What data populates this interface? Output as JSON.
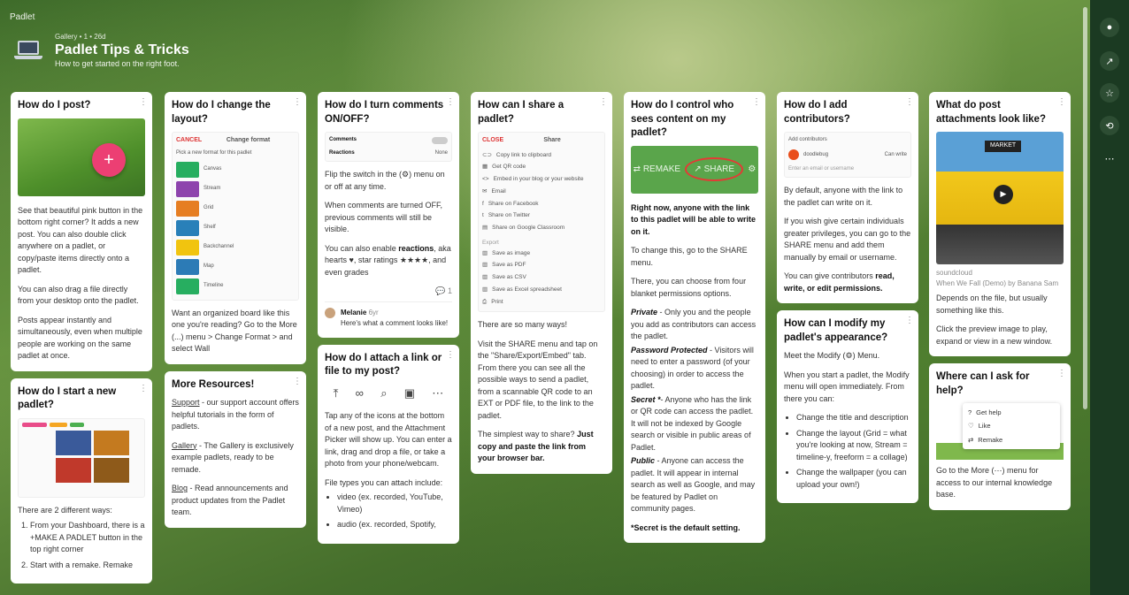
{
  "brand": "Padlet",
  "header": {
    "meta": "Gallery • 1 • 26d",
    "title": "Padlet Tips & Tricks",
    "desc": "How to get started on the right foot."
  },
  "colors": {
    "accent_pink": "#ec3f73",
    "rail": "#1b3a22",
    "share_green": "#5aa54b"
  },
  "rail_icons": [
    "user-icon",
    "share-icon",
    "star-icon",
    "remake-icon",
    "more-icon"
  ],
  "cards": {
    "post": {
      "title": "How do I post?",
      "p1": "See that beautiful pink button in the bottom right corner? It adds a new post. You can also double click anywhere on a padlet, or copy/paste items directly onto a padlet.",
      "p2": "You can also drag a file directly from your desktop onto the padlet.",
      "p3": "Posts appear instantly and simultaneously, even when multiple people are working on the same padlet at once."
    },
    "start": {
      "title": "How do I start a new padlet?",
      "p1": "There are 2 different ways:",
      "items": [
        "From your Dashboard, there is a +MAKE A PADLET button in the top right corner",
        "Start with a remake. Remake"
      ]
    },
    "layout": {
      "title": "How do I change the layout?",
      "mini_cancel": "CANCEL",
      "mini_title": "Change format",
      "mini_hint": "Pick a new format for this padlet",
      "formats": [
        {
          "name": "Canvas",
          "color": "#27ae60"
        },
        {
          "name": "Stream",
          "color": "#8e44ad"
        },
        {
          "name": "Grid",
          "color": "#e67e22"
        },
        {
          "name": "Shelf",
          "color": "#2980b9"
        },
        {
          "name": "Backchannel",
          "color": "#f1c40f"
        },
        {
          "name": "Map",
          "color": "#2c7bb6"
        },
        {
          "name": "Timeline",
          "color": "#27ae60"
        }
      ],
      "p1": "Want an organized board like this one you're reading? Go to the More (...) menu > Change Format > and select Wall"
    },
    "resources": {
      "title": "More Resources!",
      "support_link": "Support",
      "support_text": " - our support account offers helpful tutorials in the form of padlets.",
      "gallery_link": "Gallery",
      "gallery_text": " - The Gallery is exclusively example padlets, ready to be remade.",
      "blog_link": "Blog",
      "blog_text": " - Read announcements and product updates from the Padlet team."
    },
    "comments": {
      "title": "How do I turn comments ON/OFF?",
      "mini_comments": "Comments",
      "mini_reactions": "Reactions",
      "mini_none": "None",
      "p1": "Flip the switch in the (⚙) menu on or off at any time.",
      "p2": "When comments are turned OFF, previous comments will still be visible.",
      "p3a": "You can also enable ",
      "p3b": "reactions",
      "p3c": ", aka hearts ♥, star ratings ★★★★, and even grades",
      "comment_count": "1",
      "commenter": "Melanie",
      "comment_age": "6yr",
      "comment_text": "Here's what a comment looks like!"
    },
    "attach": {
      "title": "How do I attach a link or file to my post?",
      "p1": "Tap any of the icons at the bottom of a new post, and the Attachment Picker will show up. You can enter a link, drag and drop a file, or take a photo from your phone/webcam.",
      "p2": "File types you can attach include:",
      "items": [
        "video (ex. recorded, YouTube, Vimeo)",
        "audio (ex. recorded, Spotify,"
      ]
    },
    "share": {
      "title": "How can I share a padlet?",
      "mini_close": "CLOSE",
      "mini_title": "Share",
      "options": [
        "Copy link to clipboard",
        "Get QR code",
        "Embed in your blog or your website",
        "Email",
        "Share on Facebook",
        "Share on Twitter",
        "Share on Google Classroom"
      ],
      "export_label": "Export",
      "exports": [
        "Save as image",
        "Save as PDF",
        "Save as CSV",
        "Save as Excel spreadsheet",
        "Print"
      ],
      "p1": "There are so many ways!",
      "p2": "Visit the SHARE menu and tap on the \"Share/Export/Embed\" tab. From there you can see all the possible ways to send a padlet, from a scannable QR code to an EXT or PDF file, to the link to the padlet.",
      "p3a": "The simplest way to share? ",
      "p3b": "Just copy and paste the link from your browser bar."
    },
    "control": {
      "title": "How do I control who sees content on my padlet?",
      "remake": "REMAKE",
      "share": "SHARE",
      "p1": "Right now, anyone with the link to this padlet will be able to write on it.",
      "p2": "To change this, go to the SHARE menu.",
      "p3": "There, you can choose from four blanket permissions options.",
      "private_label": "Private",
      "private_text": " - Only you and the people you add as contributors can access the padlet.",
      "password_label": "Password Protected",
      "password_text": " - Visitors will need to enter a password (of your choosing) in order to access the padlet.",
      "secret_label": "Secret *",
      "secret_text": "- Anyone who has the link or QR code can access the padlet. It will not be indexed by Google search or visible in public areas of Padlet.",
      "public_label": "Public",
      "public_text": " - Anyone can access the padlet. It will appear in internal search as well as Google, and may be featured by Padlet on community pages.",
      "footnote": "*Secret is the default setting."
    },
    "contributors": {
      "title": "How do I add contributors?",
      "mini_header": "Add contributors",
      "mini_user": "doodlebug",
      "mini_role": "Can write",
      "mini_input": "Enter an email or username",
      "p1": "By default, anyone with the link to the padlet can write on it.",
      "p2": "If you wish give certain individuals greater privileges, you can go to the SHARE menu and add them manually by email or username.",
      "p3a": "You can give contributors ",
      "p3b": "read, write, or edit permissions."
    },
    "modify": {
      "title": "How can I modify my padlet's appearance?",
      "p1": "Meet the Modify (⚙) Menu.",
      "p2": "When you start a padlet, the Modify menu will open immediately. From there you can:",
      "items": [
        "Change the title and description",
        "Change the layout (Grid = what you're looking at now, Stream = timeline-y, freeform = a collage)",
        "Change the wallpaper (you can upload your own!)"
      ]
    },
    "attachments": {
      "title": "What do post attachments look like?",
      "photo_label": "MARKET",
      "source": "soundcloud",
      "caption": "When We Fall (Demo) by Banana Sam",
      "p1": "Depends on the file, but usually something like this.",
      "p2": "Click the preview image to play, expand or view in a new window."
    },
    "help": {
      "title": "Where can I ask for help?",
      "menu": [
        "Get help",
        "Like",
        "Remake"
      ],
      "p1": "Go to the More (⋯) menu for access to our internal knowledge base."
    }
  }
}
